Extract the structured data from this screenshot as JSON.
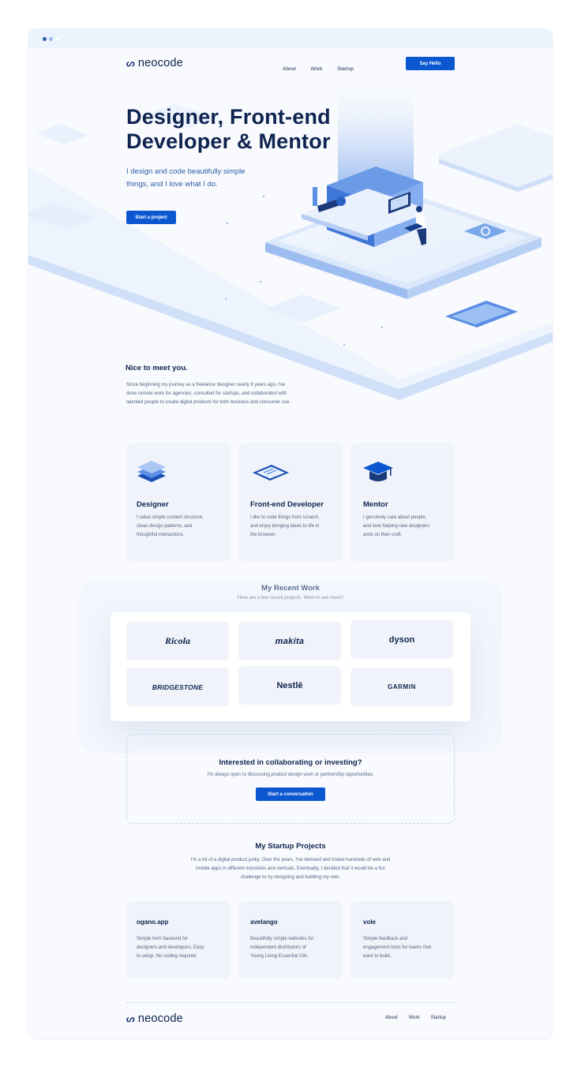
{
  "window": {
    "dot_colors": [
      "#2d5ea8",
      "#9bb9e8",
      "#ffffff"
    ]
  },
  "header": {
    "logo_mark": "ᔕ",
    "logo_text": "neocode",
    "nav": [
      "About",
      "Work",
      "Startup"
    ],
    "cta": "Say Hello"
  },
  "hero": {
    "title_line1": "Designer, Front-end",
    "title_line2": "Developer & Mentor",
    "lead_line1": "I design and code beautifully simple",
    "lead_line2": "things, and I love what I do.",
    "button": "Start a project"
  },
  "intro": {
    "title": "Nice to meet you.",
    "lines": [
      "Since beginning my journey as a freelance designer nearly 8 years ago, I've",
      "done remote work for agencies, consulted for startups, and collaborated with",
      "talented people to create digital products for both business and consumer use."
    ]
  },
  "skills": [
    {
      "title": "Designer",
      "icon": "layers-icon",
      "lines": [
        "I value simple content structure,",
        "clean design patterns, and",
        "thoughtful interactions."
      ]
    },
    {
      "title": "Front-end Developer",
      "icon": "code-editor-icon",
      "lines": [
        "I like to code things from scratch,",
        "and enjoy bringing ideas to life in",
        "the browser."
      ]
    },
    {
      "title": "Mentor",
      "icon": "graduation-cap-icon",
      "lines": [
        "I genuinely care about people,",
        "and love helping new designers",
        "work on their craft."
      ]
    }
  ],
  "work": {
    "title": "My Recent Work",
    "subtitle": "Here are a few recent projects. Want to see more?",
    "clients": [
      "Ricola",
      "makita",
      "dyson",
      "BRIDGESTONE",
      "Nestlē",
      "GARMIN"
    ]
  },
  "collab": {
    "title": "Interested in collaborating or investing?",
    "subtitle": "I'm always open to discussing product design work or partnership opportunities.",
    "button": "Start a conversation"
  },
  "startups": {
    "title": "My Startup Projects",
    "lines": [
      "I'm a bit of a digital product junky. Over the years, I've demoed and trialed hundreds of web and",
      "mobile apps in different industries and verticals. Eventually, I decided that it would be a fun",
      "challenge to try designing and building my own."
    ],
    "projects": [
      {
        "name": "ogano.app",
        "lines": [
          "Simple form backend for",
          "designers and developers. Easy",
          "to setup. No coding required."
        ]
      },
      {
        "name": "avelango",
        "lines": [
          "Beautifully simple websites for",
          "independent distributors of",
          "Young Living Essential Oils."
        ]
      },
      {
        "name": "vole",
        "lines": [
          "Simple feedback and",
          "engagement tools for teams that",
          "want to build."
        ]
      }
    ]
  },
  "footer": {
    "logo_mark": "ᔕ",
    "logo_text": "neocode",
    "nav": [
      "About",
      "Work",
      "Startup"
    ]
  },
  "colors": {
    "accent": "#0b57d0",
    "heading": "#0f2450",
    "background": "#f8fafd"
  }
}
